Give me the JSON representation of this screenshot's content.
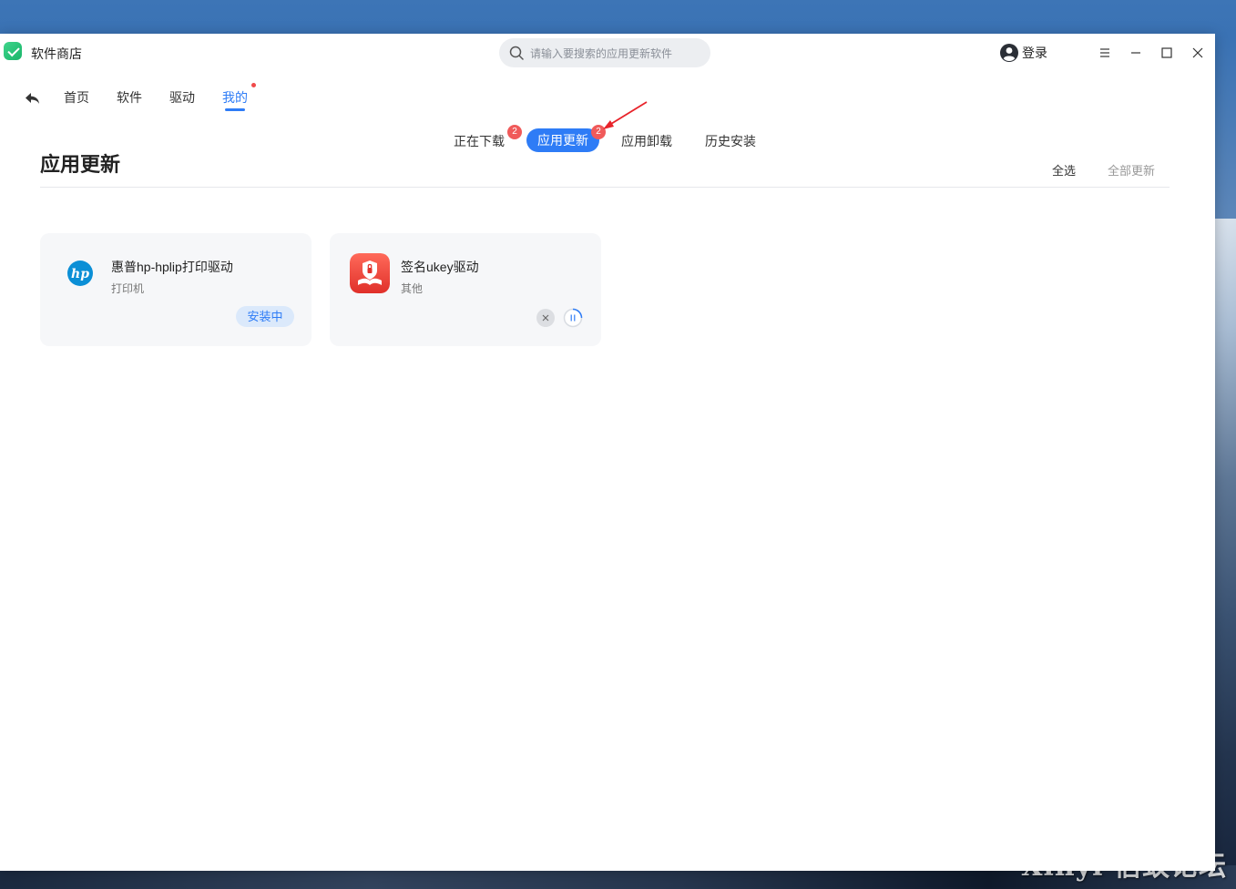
{
  "app": {
    "title": "软件商店"
  },
  "search": {
    "placeholder": "请输入要搜索的应用更新软件"
  },
  "account": {
    "login_label": "登录"
  },
  "nav": {
    "items": [
      {
        "label": "首页"
      },
      {
        "label": "软件"
      },
      {
        "label": "驱动"
      },
      {
        "label": "我的",
        "active": true
      }
    ]
  },
  "subtabs": {
    "downloading": {
      "label": "正在下载",
      "badge": "2"
    },
    "updates": {
      "label": "应用更新",
      "badge": "2",
      "active": true
    },
    "uninstall": {
      "label": "应用卸载"
    },
    "history": {
      "label": "历史安装"
    }
  },
  "page": {
    "title": "应用更新",
    "select_all": "全选",
    "update_all": "全部更新"
  },
  "cards": [
    {
      "name": "惠普hp-hplip打印驱动",
      "category": "打印机",
      "status": "安装中",
      "icon": "hp-logo-icon"
    },
    {
      "name": "签名ukey驱动",
      "category": "其他",
      "icon": "ukey-app-icon"
    }
  ],
  "watermark": "Xinyi 信蚁论坛",
  "colors": {
    "accent": "#2e7cf6",
    "badge": "#f05a5a",
    "card_bg": "#f6f7f9"
  }
}
